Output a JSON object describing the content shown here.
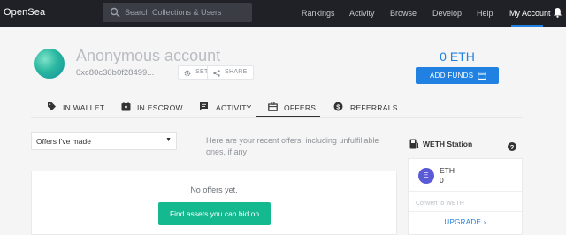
{
  "nav": {
    "logo": "OpenSea",
    "search_placeholder": "Search Collections & Users",
    "links": [
      "Rankings",
      "Activity",
      "Browse",
      "Develop",
      "Help",
      "My Account"
    ],
    "active": "My Account"
  },
  "profile": {
    "name": "Anonymous account",
    "address": "0xc80c30b0f28499...",
    "settings_label": "SETTINGS",
    "share_label": "SHARE",
    "eth_balance": "0 ETH",
    "add_funds_label": "ADD FUNDS"
  },
  "tabs": [
    {
      "label": "IN WALLET",
      "icon": "tag-icon"
    },
    {
      "label": "IN ESCROW",
      "icon": "escrow-icon"
    },
    {
      "label": "ACTIVITY",
      "icon": "activity-icon"
    },
    {
      "label": "OFFERS",
      "icon": "offers-icon"
    },
    {
      "label": "REFERRALS",
      "icon": "dollar-icon"
    }
  ],
  "active_tab": "OFFERS",
  "offers": {
    "filter_value": "Offers I've made",
    "hint": "Here are your recent offers, including unfulfillable ones, if any",
    "empty_text": "No offers yet.",
    "cta_label": "Find assets you can bid on"
  },
  "weth": {
    "title": "WETH Station",
    "token_name": "ETH",
    "token_amount": "0",
    "token_symbol": "Ξ",
    "convert_placeholder": "Convert to WETH",
    "upgrade_label": "UPGRADE  ›"
  },
  "colors": {
    "nav_bg": "#1f2126",
    "accent_blue": "#2081e2",
    "cta_green": "#15b98f"
  }
}
